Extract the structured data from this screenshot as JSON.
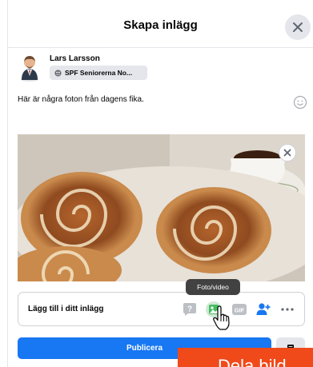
{
  "dialog": {
    "title": "Skapa inlägg",
    "close_icon": "close-icon"
  },
  "author": {
    "name": "Lars Larsson",
    "audience": "SPF Seniorerna No...",
    "audience_icon": "group-icon"
  },
  "post": {
    "text": "Här är några foton från dagens fika.",
    "emoji_icon": "emoji-icon"
  },
  "photo": {
    "subject": "cinnamon-buns-and-coffee-photo",
    "remove_icon": "close-icon"
  },
  "tooltip": {
    "text": "Foto/video"
  },
  "add_to_post": {
    "label": "Lägg till i ditt inlägg",
    "icons": [
      "question-icon",
      "photo-video-icon",
      "gif-icon",
      "tag-people-icon",
      "more-icon"
    ]
  },
  "actions": {
    "publish_label": "Publicera"
  },
  "overlay": {
    "banner_text": "Dela bild"
  },
  "colors": {
    "accent": "#1877f2",
    "photo_green": "#45bd62",
    "banner": "#f04a1b",
    "background": "#ffffff"
  }
}
